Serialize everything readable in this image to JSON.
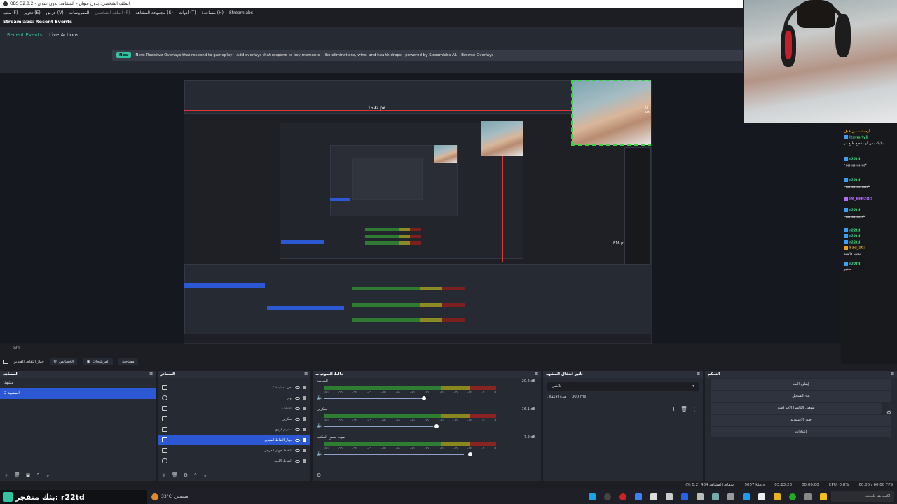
{
  "window": {
    "title": "OBS 32.0.2 - الملف الشخصي: بدون عنوان - المشاهد: بدون عنوان"
  },
  "menu": [
    "ملف (F)",
    "تحرير (E)",
    "عرض (V)",
    "المفروشات",
    "الملف الشخصي (P)",
    "مجموعة المشاهد (S)",
    "أدوات (T)",
    "مساعدة (H)",
    "Streamlabs"
  ],
  "dock": {
    "title": "Streamlabs: Recent Events",
    "tabs": [
      {
        "label": "Recent Events",
        "active": true
      },
      {
        "label": "Live Actions",
        "active": false
      }
    ],
    "banner": {
      "pill": "New",
      "headline": "New: Reactive Overlays that respond to gameplay",
      "body": "Add overlays that respond to key moments—like eliminations, wins, and health drops—powered by Streamlabs AI.",
      "link": "Browse Overlays"
    }
  },
  "preview": {
    "size_label_w": "1592 px",
    "size_label_h": "816 px",
    "size_label_right": "0 px",
    "status_zoom": "69%"
  },
  "controls": [
    "الخصائص",
    "المرشحات",
    "مصاحبة",
    "جهاز التقاط الفيديو"
  ],
  "scenes": {
    "title": "المشاهد",
    "items": [
      {
        "label": "مشهد",
        "selected": false
      },
      {
        "label": "المشهد 2",
        "selected": true
      }
    ]
  },
  "sources": {
    "title": "المصادر",
    "items": [
      {
        "label": "نص مسابقة 2",
        "selected": false
      },
      {
        "label": "أوار",
        "selected": false
      },
      {
        "label": "الشاشة",
        "selected": false
      },
      {
        "label": "سكرين",
        "selected": false
      },
      {
        "label": "ستريم اوري",
        "selected": false
      },
      {
        "label": "جهاز التقاط الفيديو",
        "selected": true
      },
      {
        "label": "التقاط جهاز العرض",
        "selected": false
      },
      {
        "label": "التقاط اللعبة",
        "selected": false
      }
    ]
  },
  "mixer": {
    "title": "خالط الصوتيات",
    "channels": [
      {
        "name": "الشاشة",
        "db": "-20.2 dB",
        "level": 0.6
      },
      {
        "name": "سكرين",
        "db": "-16.1 dB",
        "level": 0.65
      },
      {
        "name": "صوت سطح المكتب",
        "db": "-7.9 dB",
        "level": 0.85
      }
    ],
    "scale": [
      "-60",
      "-55",
      "-50",
      "-45",
      "-40",
      "-35",
      "-30",
      "-25",
      "-20",
      "-15",
      "-10",
      "-5",
      "0"
    ]
  },
  "transitions": {
    "title": "تأثير انتقال المشهد",
    "selected": "تلاشي",
    "duration_label": "مدة الانتقال",
    "duration_value": "300 ms"
  },
  "controls_panel": {
    "title": "التحكم",
    "buttons": [
      "إيقاف البث",
      "بدء التسجيل",
      "تشغيل الكاميرا الافتراضية",
      "طور الاستوديو",
      "إعدادات"
    ]
  },
  "statusbar": {
    "dropped": "إسقاط المشاهد 484 (0.2 %)",
    "bitrate": "9057 kbps",
    "live_time": "03:13:28",
    "rec_time": "00:00:00",
    "cpu": "CPU: 0.8%",
    "fps": "60.00 / 60.00 FPS"
  },
  "taskbar": {
    "streamer": "بثك منفجر: r22td",
    "weather_temp": "33°C",
    "weather_text": "مشمس",
    "search_placeholder": "اكتب هنا للبحث"
  },
  "chat": {
    "messages": [
      {
        "user": "أرسلت من قبل",
        "text": "",
        "color": "gold"
      },
      {
        "user": "itsmarly1",
        "text": "بكيكه بس لو مقطع طلع مر",
        "color": "green"
      },
      {
        "user": "r22td",
        "text": "هههههههههههههه",
        "color": "green"
      },
      {
        "user": "r22td",
        "text": "هههههههههههههههه",
        "color": "green"
      },
      {
        "user": "IM_RENZOO",
        "text": "",
        "color": "purple"
      },
      {
        "user": "r22td",
        "text": "ههههههههههههه",
        "color": "green"
      },
      {
        "user": "r22td",
        "text": "",
        "color": "green"
      },
      {
        "user": "r22td",
        "text": "",
        "color": "green"
      },
      {
        "user": "r22td",
        "text": "",
        "color": "green"
      },
      {
        "user": "S3d_10:",
        "text": "يديت فاشيه",
        "color": "gold"
      },
      {
        "user": "r22td",
        "text": "متغير",
        "color": "green"
      }
    ]
  },
  "colors": {
    "accent": "#31c3a2",
    "selection": "#2d58d4",
    "red": "#e2333a",
    "green_box": "#3ad24a"
  }
}
